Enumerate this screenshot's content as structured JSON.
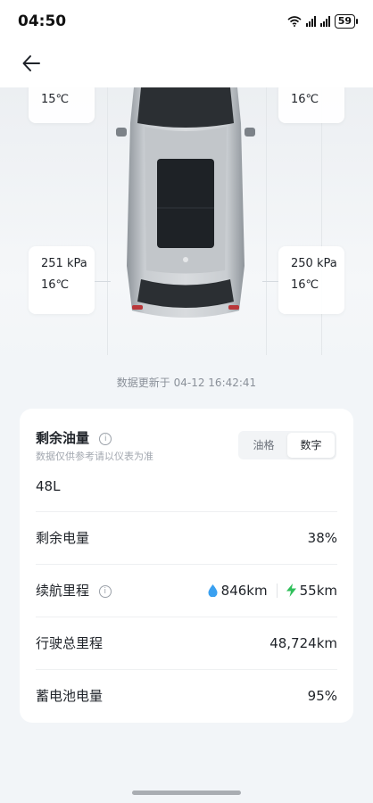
{
  "status_bar": {
    "time": "04:50",
    "battery": "59"
  },
  "tires": {
    "front_left": {
      "temp": "15℃"
    },
    "front_right": {
      "temp": "16℃"
    },
    "rear_left": {
      "pressure": "251 kPa",
      "temp": "16℃"
    },
    "rear_right": {
      "pressure": "250 kPa",
      "temp": "16℃"
    }
  },
  "update_time": "数据更新于 04-12 16:42:41",
  "fuel": {
    "title": "剩余油量",
    "note": "数据仅供参考请以仪表为准",
    "toggle": [
      "油格",
      "数字"
    ],
    "active_toggle": "数字",
    "value": "48L"
  },
  "rows": {
    "battery_level": {
      "label": "剩余电量",
      "value": "38%"
    },
    "range": {
      "label": "续航里程",
      "fuel_range": "846km",
      "electric_range": "55km"
    },
    "odometer": {
      "label": "行驶总里程",
      "value": "48,724km"
    },
    "battery_12v": {
      "label": "蓄电池电量",
      "value": "95%"
    }
  },
  "colors": {
    "fuel_drop": "#3aa0f0",
    "electric_bolt": "#2fbf5a"
  },
  "icons": {
    "back": "arrow-left-icon",
    "info": "info-circle-icon",
    "wifi": "wifi-icon",
    "signal": "signal-icon",
    "battery": "battery-icon",
    "drop": "fuel-drop-icon",
    "bolt": "lightning-bolt-icon"
  }
}
